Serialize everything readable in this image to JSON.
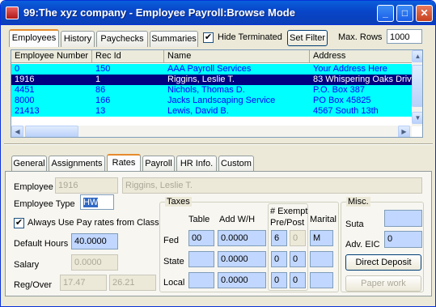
{
  "window": {
    "title": "99:The xyz company - Employee Payroll:Browse Mode"
  },
  "top_tabs": [
    "Employees",
    "History",
    "Paychecks",
    "Summaries"
  ],
  "toolbar": {
    "hide_terminated": "Hide Terminated",
    "hide_terminated_checked": true,
    "set_filter": "Set Filter",
    "max_rows_label": "Max. Rows",
    "max_rows_value": "1000"
  },
  "grid": {
    "columns": [
      "Employee Number",
      "Rec Id",
      "Name",
      "Address"
    ],
    "rows": [
      [
        "0",
        "150",
        "AAA Payroll Services",
        "Your Address Here"
      ],
      [
        "1916",
        "1",
        "Riggins, Leslie T.",
        "83 Whispering Oaks Driv"
      ],
      [
        "4451",
        "86",
        "Nichols, Thomas D.",
        "P.O. Box 387"
      ],
      [
        "8000",
        "166",
        "Jacks Landscaping Service",
        "PO Box 45825"
      ],
      [
        "21413",
        "13",
        "Lewis, David B.",
        "4567 South 13th"
      ]
    ],
    "selected_row": 1
  },
  "detail_tabs": [
    "General",
    "Assignments",
    "Rates",
    "Payroll",
    "HR Info.",
    "Custom"
  ],
  "active_detail_tab": "Rates",
  "rates": {
    "employee_label": "Employee",
    "employee_number": "1916",
    "employee_name": "Riggins, Leslie T.",
    "employee_type_label": "Employee Type",
    "employee_type": "HW",
    "always_use_label": "Always Use Pay rates from Class",
    "always_use_checked": true,
    "default_hours_label": "Default Hours",
    "default_hours": "40.0000",
    "salary_label": "Salary",
    "salary": "0.0000",
    "reg_over_label": "Reg/Over",
    "reg": "17.47",
    "over": "26.21"
  },
  "taxes": {
    "title": "Taxes",
    "col_table": "Table",
    "col_addwh": "Add W/H",
    "col_exempt1": "# Exempt",
    "col_exempt2": "Pre/Post",
    "col_marital": "Marital",
    "rows": [
      {
        "label": "Fed",
        "table": "00",
        "addwh": "0.0000",
        "pre": "6",
        "post": "0",
        "marital": "M"
      },
      {
        "label": "State",
        "table": "",
        "addwh": "0.0000",
        "pre": "0",
        "post": "0",
        "marital": ""
      },
      {
        "label": "Local",
        "table": "",
        "addwh": "0.0000",
        "pre": "0",
        "post": "0",
        "marital": ""
      }
    ]
  },
  "misc": {
    "title": "Misc.",
    "suta_label": "Suta",
    "suta": "",
    "adv_eic_label": "Adv. EIC",
    "adv_eic": "0",
    "direct_deposit": "Direct Deposit",
    "paper_work": "Paper work"
  }
}
